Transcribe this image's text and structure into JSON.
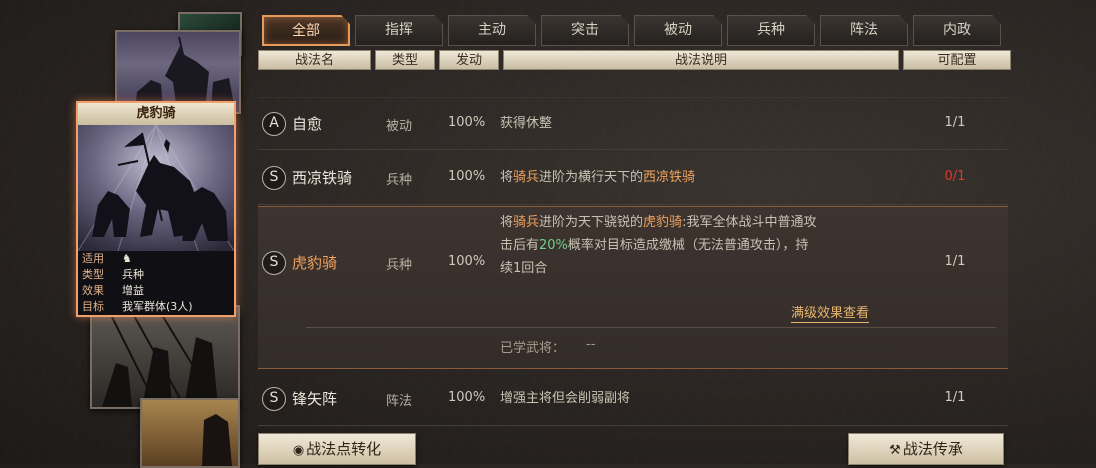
{
  "tabs": [
    "全部",
    "指挥",
    "主动",
    "突击",
    "被动",
    "兵种",
    "阵法",
    "内政"
  ],
  "active_tab_index": 0,
  "columns": {
    "name": "战法名",
    "type": "类型",
    "trigger": "发动",
    "desc": "战法说明",
    "config": "可配置"
  },
  "tactics": [
    {
      "grade": "A",
      "name": "自愈",
      "type": "被动",
      "rate": "100%",
      "desc": "获得休整",
      "config": "1/1"
    },
    {
      "grade": "S",
      "name": "西凉铁骑",
      "type": "兵种",
      "rate": "100%",
      "desc_parts": [
        "将",
        "骑兵",
        "进阶为横行天下的",
        "西凉铁骑"
      ],
      "config": "0/1",
      "config_color": "#d83b2c"
    },
    {
      "grade": "S",
      "name": "锋矢阵",
      "type": "阵法",
      "rate": "100%",
      "desc": "增强主将但会削弱副将",
      "config": "1/1"
    }
  ],
  "selected_tactic": {
    "grade": "S",
    "name": "虎豹骑",
    "type": "兵种",
    "rate": "100%",
    "config": "1/1",
    "desc_line1": [
      "将",
      "骑兵",
      "进阶为天下骁锐的",
      "虎豹骑",
      ":我军全体战斗中普通攻"
    ],
    "desc_line2": [
      "击后有",
      "20%",
      "概率对目标造成缴械（无法普通攻击），持"
    ],
    "desc_line3": "续1回合",
    "max_level_link": "满级效果查看",
    "learned_label": "已学武将：",
    "learned_value": "--"
  },
  "card": {
    "title": "虎豹骑",
    "info": [
      {
        "key": "适用",
        "value": ""
      },
      {
        "key": "类型",
        "value": "兵种"
      },
      {
        "key": "效果",
        "value": "增益"
      },
      {
        "key": "目标",
        "value": "我军群体(3人)"
      }
    ]
  },
  "buttons": {
    "convert": "战法点转化",
    "inherit": "战法传承"
  },
  "colors": {
    "highlight": "#f0a25e",
    "percent_green": "#6ed28a",
    "active_tab_border": "#e39a5a"
  }
}
